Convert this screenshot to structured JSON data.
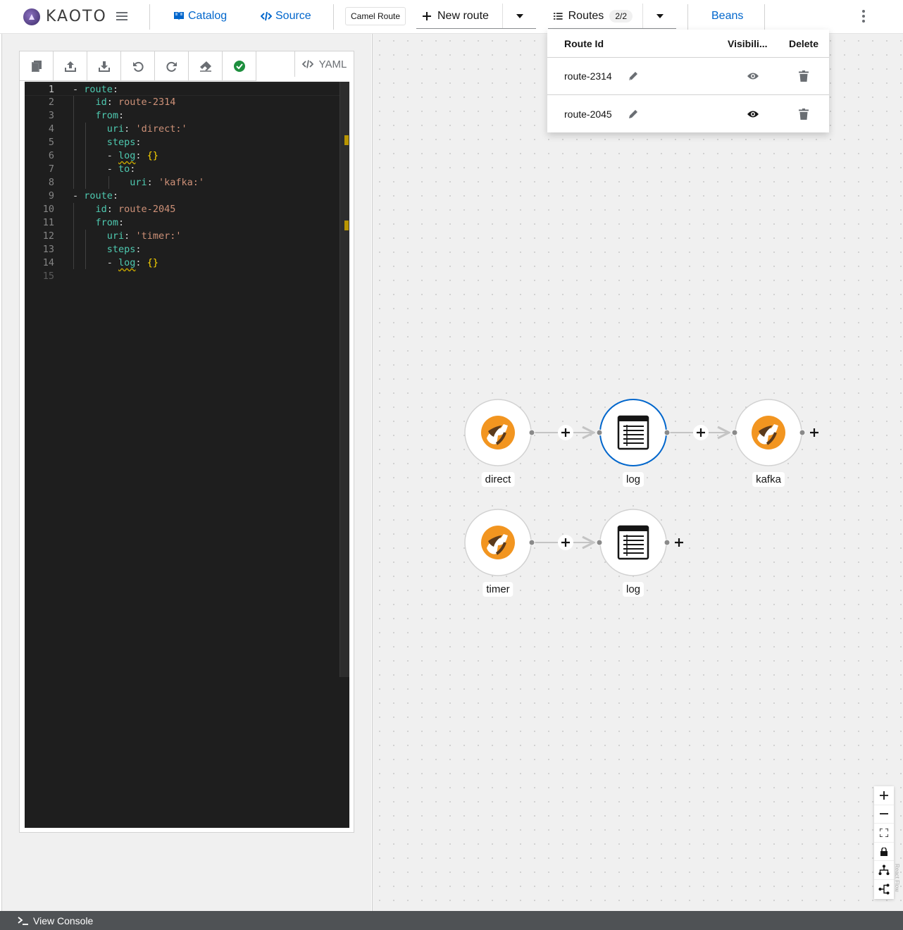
{
  "header": {
    "brand": "KAOTO",
    "nav": {
      "catalog": "Catalog",
      "source": "Source"
    },
    "camel_route": "Camel Route",
    "new_route": "New route",
    "routes": {
      "label": "Routes",
      "count": "2/2"
    },
    "beans": "Beans"
  },
  "routes_menu": {
    "headers": {
      "id": "Route Id",
      "visibility": "Visibili...",
      "delete": "Delete"
    },
    "rows": [
      {
        "id": "route-2314"
      },
      {
        "id": "route-2045"
      }
    ]
  },
  "editor": {
    "tab": "YAML",
    "lines": [
      "1",
      "2",
      "3",
      "4",
      "5",
      "6",
      "7",
      "8",
      "9",
      "10",
      "11",
      "12",
      "13",
      "14",
      "15"
    ]
  },
  "canvas": {
    "nodes": {
      "r1_direct": "direct",
      "r1_log": "log",
      "r1_kafka": "kafka",
      "r2_timer": "timer",
      "r2_log": "log"
    },
    "attribution": "React Flow"
  },
  "footer": {
    "console": "View Console"
  },
  "colors": {
    "accent": "#0066cc",
    "camel_orange": "#f29520",
    "selected_node": "#0066cc"
  }
}
